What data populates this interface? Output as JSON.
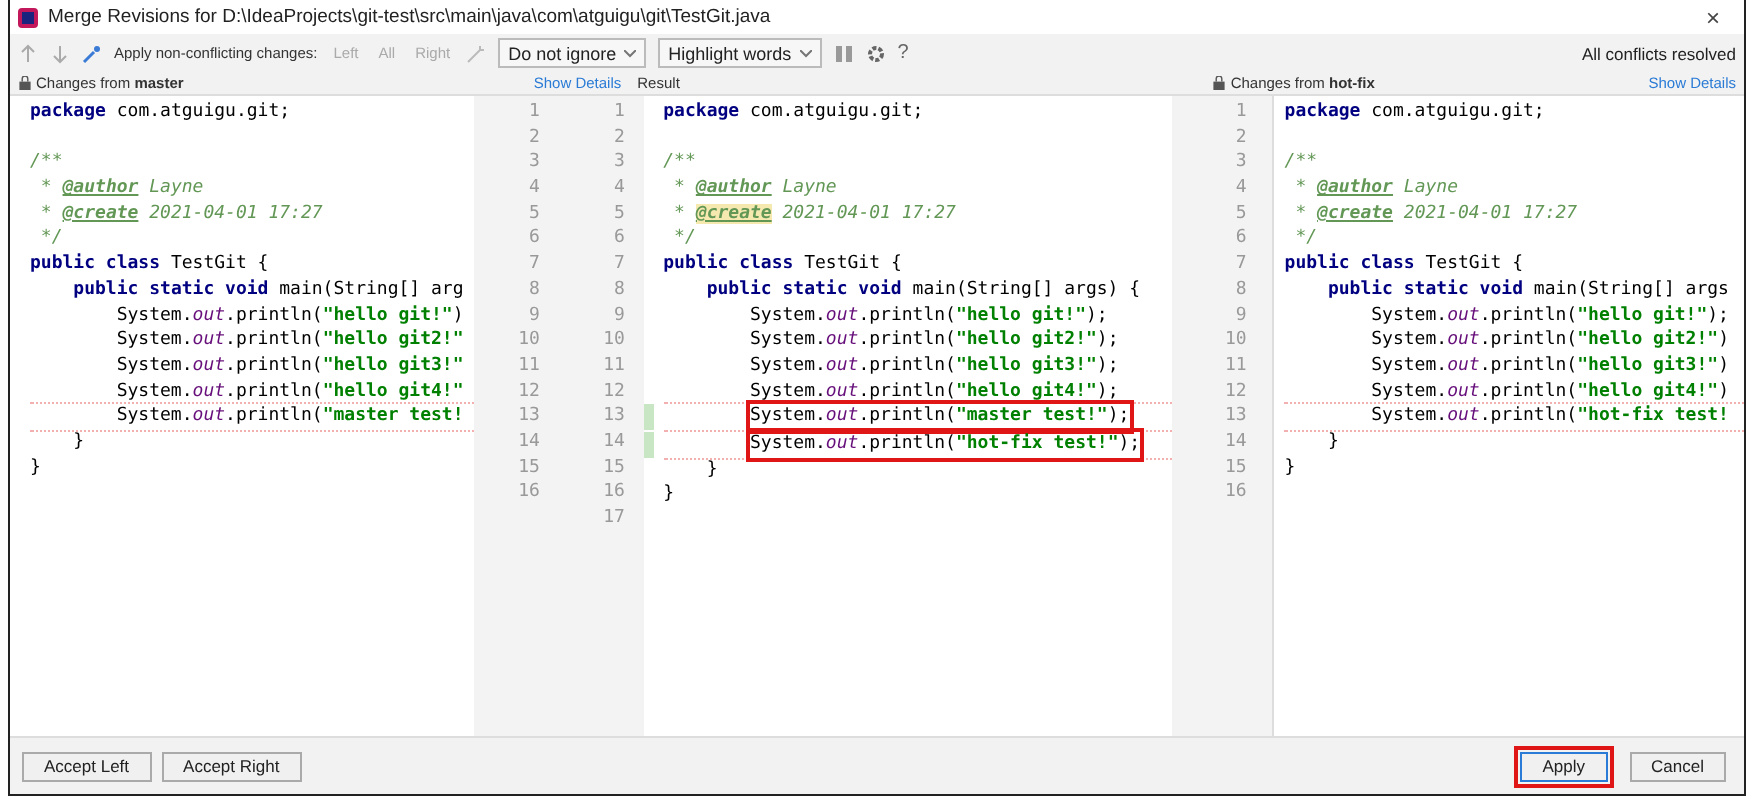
{
  "window": {
    "title": "Merge Revisions for D:\\IdeaProjects\\git-test\\src\\main\\java\\com\\atguigu\\git\\TestGit.java",
    "close": "×"
  },
  "toolbar": {
    "apply_label": "Apply non-conflicting changes:",
    "actions": [
      {
        "label": "Left",
        "disabled": true
      },
      {
        "label": "All",
        "disabled": true
      },
      {
        "label": "Right",
        "disabled": true
      }
    ],
    "ignore_select": "Do not ignore",
    "highlight_select": "Highlight words",
    "help": "?",
    "status": "All conflicts resolved"
  },
  "left_header": {
    "prefix": "Changes from ",
    "branch": "master",
    "link": "Show Details"
  },
  "result_header": "Result",
  "right_header": {
    "prefix": "Changes from ",
    "branch": "hot-fix",
    "link": "Show Details"
  },
  "left_pane": [
    {
      "kind": "code",
      "tokens": [
        {
          "kind": "keyword",
          "text": "package"
        },
        {
          "kind": "plain",
          "text": " com.atguigu.git;"
        }
      ]
    },
    {
      "kind": "blank"
    },
    {
      "kind": "code",
      "tokens": [
        {
          "kind": "comment",
          "text": "/**"
        }
      ]
    },
    {
      "kind": "code",
      "tokens": [
        {
          "kind": "comment",
          "text": " * "
        },
        {
          "kind": "doctag",
          "text": "@author"
        },
        {
          "kind": "comment",
          "text": " Layne"
        }
      ]
    },
    {
      "kind": "code",
      "tokens": [
        {
          "kind": "comment",
          "text": " * "
        },
        {
          "kind": "doctag",
          "text": "@create"
        },
        {
          "kind": "comment",
          "text": " 2021-04-01 17:27"
        }
      ]
    },
    {
      "kind": "code",
      "tokens": [
        {
          "kind": "comment",
          "text": " */"
        }
      ]
    },
    {
      "kind": "code",
      "tokens": [
        {
          "kind": "keyword",
          "text": "public class"
        },
        {
          "kind": "plain",
          "text": " TestGit {"
        }
      ]
    },
    {
      "kind": "code",
      "tokens": [
        {
          "kind": "indent_single"
        },
        {
          "kind": "keyword",
          "text": "public static void"
        },
        {
          "kind": "plain",
          "text": " main(String[] arg"
        }
      ]
    },
    {
      "kind": "code",
      "tokens": [
        {
          "kind": "indent_double"
        },
        {
          "kind": "plain",
          "text": "System."
        },
        {
          "kind": "field",
          "text": "out"
        },
        {
          "kind": "plain",
          "text": ".println("
        },
        {
          "kind": "string",
          "text": "\"hello git!\""
        },
        {
          "kind": "plain",
          "text": ")"
        }
      ]
    },
    {
      "kind": "code",
      "tokens": [
        {
          "kind": "indent_double"
        },
        {
          "kind": "plain",
          "text": "System."
        },
        {
          "kind": "field",
          "text": "out"
        },
        {
          "kind": "plain",
          "text": ".println("
        },
        {
          "kind": "string",
          "text": "\"hello git2!\""
        }
      ]
    },
    {
      "kind": "code",
      "tokens": [
        {
          "kind": "indent_double"
        },
        {
          "kind": "plain",
          "text": "System."
        },
        {
          "kind": "field",
          "text": "out"
        },
        {
          "kind": "plain",
          "text": ".println("
        },
        {
          "kind": "string",
          "text": "\"hello git3!\""
        }
      ]
    },
    {
      "kind": "code",
      "tokens": [
        {
          "kind": "indent_double"
        },
        {
          "kind": "plain",
          "text": "System."
        },
        {
          "kind": "field",
          "text": "out"
        },
        {
          "kind": "plain",
          "text": ".println("
        },
        {
          "kind": "string",
          "text": "\"hello git4!\""
        }
      ]
    },
    {
      "kind": "code",
      "changed": true,
      "tokens": [
        {
          "kind": "indent_double"
        },
        {
          "kind": "plain",
          "text": "System."
        },
        {
          "kind": "field",
          "text": "out"
        },
        {
          "kind": "plain",
          "text": ".println("
        },
        {
          "kind": "string",
          "text": "\"master test!"
        }
      ]
    },
    {
      "kind": "code",
      "tokens": [
        {
          "kind": "indent_single"
        },
        {
          "kind": "plain",
          "text": "}"
        }
      ]
    },
    {
      "kind": "code",
      "tokens": [
        {
          "kind": "plain",
          "text": "}"
        }
      ]
    }
  ],
  "left_gutter": {
    "left_numbers": [
      "1",
      "2",
      "3",
      "4",
      "5",
      "6",
      "7",
      "8",
      "9",
      "10",
      "11",
      "12",
      "13",
      "14",
      "15",
      "16"
    ],
    "right_numbers": [
      "1",
      "2",
      "3",
      "4",
      "5",
      "6",
      "7",
      "8",
      "9",
      "10",
      "11",
      "12",
      "13",
      "14",
      "15",
      "16",
      "17"
    ]
  },
  "result_pane": [
    {
      "kind": "code",
      "tokens": [
        {
          "kind": "keyword",
          "text": "package"
        },
        {
          "kind": "plain",
          "text": " com.atguigu.git;"
        }
      ]
    },
    {
      "kind": "blank"
    },
    {
      "kind": "code",
      "tokens": [
        {
          "kind": "comment",
          "text": "/**"
        }
      ]
    },
    {
      "kind": "code",
      "tokens": [
        {
          "kind": "comment",
          "text": " * "
        },
        {
          "kind": "doctag",
          "text": "@author"
        },
        {
          "kind": "comment",
          "text": " Layne"
        }
      ]
    },
    {
      "kind": "code",
      "tokens": [
        {
          "kind": "comment",
          "text": " * "
        },
        {
          "kind": "doctag_changed",
          "text": "@create"
        },
        {
          "kind": "comment",
          "text": " 2021-04-01 17:27"
        }
      ]
    },
    {
      "kind": "code",
      "tokens": [
        {
          "kind": "comment",
          "text": " */"
        }
      ]
    },
    {
      "kind": "code",
      "tokens": [
        {
          "kind": "keyword",
          "text": "public class"
        },
        {
          "kind": "plain",
          "text": " TestGit {"
        }
      ]
    },
    {
      "kind": "code",
      "tokens": [
        {
          "kind": "indent_single"
        },
        {
          "kind": "keyword",
          "text": "public static void"
        },
        {
          "kind": "plain",
          "text": " main(String[] args) {"
        }
      ]
    },
    {
      "kind": "code",
      "tokens": [
        {
          "kind": "indent_double"
        },
        {
          "kind": "plain",
          "text": "System."
        },
        {
          "kind": "field",
          "text": "out"
        },
        {
          "kind": "plain",
          "text": ".println("
        },
        {
          "kind": "string",
          "text": "\"hello git!\""
        },
        {
          "kind": "plain",
          "text": ");"
        }
      ]
    },
    {
      "kind": "code",
      "tokens": [
        {
          "kind": "indent_double"
        },
        {
          "kind": "plain",
          "text": "System."
        },
        {
          "kind": "field",
          "text": "out"
        },
        {
          "kind": "plain",
          "text": ".println("
        },
        {
          "kind": "string",
          "text": "\"hello git2!\""
        },
        {
          "kind": "plain",
          "text": ");"
        }
      ]
    },
    {
      "kind": "code",
      "tokens": [
        {
          "kind": "indent_double"
        },
        {
          "kind": "plain",
          "text": "System."
        },
        {
          "kind": "field",
          "text": "out"
        },
        {
          "kind": "plain",
          "text": ".println("
        },
        {
          "kind": "string",
          "text": "\"hello git3!\""
        },
        {
          "kind": "plain",
          "text": ");"
        }
      ]
    },
    {
      "kind": "code",
      "tokens": [
        {
          "kind": "indent_double"
        },
        {
          "kind": "plain",
          "text": "System."
        },
        {
          "kind": "field",
          "text": "out"
        },
        {
          "kind": "plain",
          "text": ".println("
        },
        {
          "kind": "string",
          "text": "\"hello git4!\""
        },
        {
          "kind": "plain",
          "text": ");"
        }
      ]
    },
    {
      "kind": "code",
      "changed": true,
      "boxed": true,
      "tokens": [
        {
          "kind": "indent_double"
        },
        {
          "kind": "plain",
          "text": "System."
        },
        {
          "kind": "field",
          "text": "out"
        },
        {
          "kind": "plain",
          "text": ".println("
        },
        {
          "kind": "string",
          "text": "\"master test!\""
        },
        {
          "kind": "plain",
          "text": ");"
        }
      ]
    },
    {
      "kind": "code",
      "changed": true,
      "boxed": true,
      "tokens": [
        {
          "kind": "indent_double"
        },
        {
          "kind": "plain",
          "text": "System."
        },
        {
          "kind": "field",
          "text": "out"
        },
        {
          "kind": "plain",
          "text": ".println("
        },
        {
          "kind": "string",
          "text": "\"hot-fix test!\""
        },
        {
          "kind": "plain",
          "text": ");"
        }
      ]
    },
    {
      "kind": "code",
      "tokens": [
        {
          "kind": "indent_single"
        },
        {
          "kind": "plain",
          "text": "}"
        }
      ]
    },
    {
      "kind": "code",
      "tokens": [
        {
          "kind": "plain",
          "text": "}"
        }
      ]
    }
  ],
  "right_gutter": [
    "1",
    "2",
    "3",
    "4",
    "5",
    "6",
    "7",
    "8",
    "9",
    "10",
    "11",
    "12",
    "13",
    "14",
    "15",
    "16"
  ],
  "right_pane": [
    {
      "kind": "code",
      "tokens": [
        {
          "kind": "keyword",
          "text": "package"
        },
        {
          "kind": "plain",
          "text": " com.atguigu.git;"
        }
      ]
    },
    {
      "kind": "blank"
    },
    {
      "kind": "code",
      "tokens": [
        {
          "kind": "comment",
          "text": "/**"
        }
      ]
    },
    {
      "kind": "code",
      "tokens": [
        {
          "kind": "comment",
          "text": " * "
        },
        {
          "kind": "doctag",
          "text": "@author"
        },
        {
          "kind": "comment",
          "text": " Layne"
        }
      ]
    },
    {
      "kind": "code",
      "tokens": [
        {
          "kind": "comment",
          "text": " * "
        },
        {
          "kind": "doctag",
          "text": "@create"
        },
        {
          "kind": "comment",
          "text": " 2021-04-01 17:27"
        }
      ]
    },
    {
      "kind": "code",
      "tokens": [
        {
          "kind": "comment",
          "text": " */"
        }
      ]
    },
    {
      "kind": "code",
      "tokens": [
        {
          "kind": "keyword",
          "text": "public class"
        },
        {
          "kind": "plain",
          "text": " TestGit {"
        }
      ]
    },
    {
      "kind": "code",
      "tokens": [
        {
          "kind": "indent_single"
        },
        {
          "kind": "keyword",
          "text": "public static void"
        },
        {
          "kind": "plain",
          "text": " main(String[] args"
        }
      ]
    },
    {
      "kind": "code",
      "tokens": [
        {
          "kind": "indent_double"
        },
        {
          "kind": "plain",
          "text": "System."
        },
        {
          "kind": "field",
          "text": "out"
        },
        {
          "kind": "plain",
          "text": ".println("
        },
        {
          "kind": "string",
          "text": "\"hello git!\""
        },
        {
          "kind": "plain",
          "text": ");"
        }
      ]
    },
    {
      "kind": "code",
      "tokens": [
        {
          "kind": "indent_double"
        },
        {
          "kind": "plain",
          "text": "System."
        },
        {
          "kind": "field",
          "text": "out"
        },
        {
          "kind": "plain",
          "text": ".println("
        },
        {
          "kind": "string",
          "text": "\"hello git2!\""
        },
        {
          "kind": "plain",
          "text": ")"
        }
      ]
    },
    {
      "kind": "code",
      "tokens": [
        {
          "kind": "indent_double"
        },
        {
          "kind": "plain",
          "text": "System."
        },
        {
          "kind": "field",
          "text": "out"
        },
        {
          "kind": "plain",
          "text": ".println("
        },
        {
          "kind": "string",
          "text": "\"hello git3!\""
        },
        {
          "kind": "plain",
          "text": ")"
        }
      ]
    },
    {
      "kind": "code",
      "tokens": [
        {
          "kind": "indent_double"
        },
        {
          "kind": "plain",
          "text": "System."
        },
        {
          "kind": "field",
          "text": "out"
        },
        {
          "kind": "plain",
          "text": ".println("
        },
        {
          "kind": "string",
          "text": "\"hello git4!\""
        },
        {
          "kind": "plain",
          "text": ")"
        }
      ]
    },
    {
      "kind": "code",
      "changed": true,
      "tokens": [
        {
          "kind": "indent_double"
        },
        {
          "kind": "plain",
          "text": "System."
        },
        {
          "kind": "field",
          "text": "out"
        },
        {
          "kind": "plain",
          "text": ".println("
        },
        {
          "kind": "string",
          "text": "\"hot-fix test!"
        }
      ]
    },
    {
      "kind": "code",
      "tokens": [
        {
          "kind": "indent_single"
        },
        {
          "kind": "plain",
          "text": "}"
        }
      ]
    },
    {
      "kind": "code",
      "tokens": [
        {
          "kind": "plain",
          "text": "}"
        }
      ]
    }
  ],
  "footer": {
    "left_buttons": [
      "Accept Left",
      "Accept Right"
    ],
    "right_buttons": [
      {
        "label": "Apply",
        "boxed": true,
        "default": true
      },
      {
        "label": "Cancel",
        "boxed": false,
        "default": false
      }
    ]
  }
}
